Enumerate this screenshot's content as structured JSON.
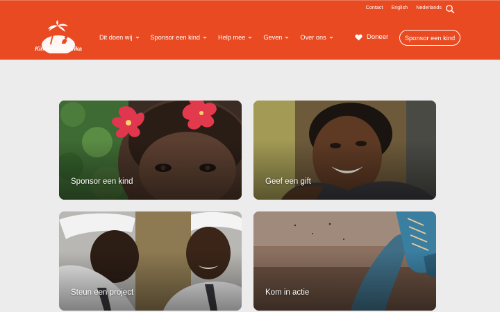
{
  "topbar": {
    "contact": "Contact",
    "english": "English",
    "dutch": "Nederlands"
  },
  "logo": {
    "name": "Kinderhulp Afrika"
  },
  "nav": [
    {
      "label": "Dit doen wij"
    },
    {
      "label": "Sponsor een kind"
    },
    {
      "label": "Help mee"
    },
    {
      "label": "Geven"
    },
    {
      "label": "Over ons"
    }
  ],
  "donate": {
    "label": "Doneer"
  },
  "cta": {
    "label": "Sponsor een kind"
  },
  "cards": [
    {
      "label": "Sponsor een kind"
    },
    {
      "label": "Geef een gift"
    },
    {
      "label": "Steun een project"
    },
    {
      "label": "Kom in actie"
    }
  ],
  "colors": {
    "brand": "#e94a22",
    "background": "#ececec"
  }
}
